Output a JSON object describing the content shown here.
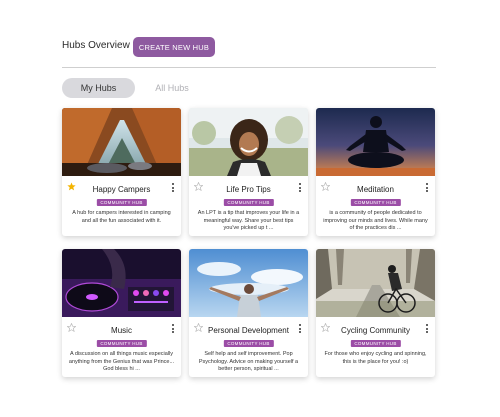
{
  "header": {
    "title": "Hubs Overview",
    "create_label": "CREATE NEW HUB"
  },
  "tabs": [
    {
      "label": "My Hubs",
      "active": true
    },
    {
      "label": "All Hubs",
      "active": false
    }
  ],
  "colors": {
    "accent": "#8e5aa0",
    "badge": "#9b4da6",
    "star_on": "#f4b400",
    "star_off": "#bdbdbd"
  },
  "hubs": [
    {
      "title": "Happy Campers",
      "badge": "COMMUNITY HUB",
      "starred": true,
      "description": "A hub for campers interested in camping and all the fun associated with it."
    },
    {
      "title": "Life Pro Tips",
      "badge": "COMMUNITY HUB",
      "starred": false,
      "description": "An LPT is a tip that improves your life in a meaningful way. Share your best tips you've picked up t ..."
    },
    {
      "title": "Meditation",
      "badge": "COMMUNITY HUB",
      "starred": false,
      "description": "is a community of people dedicated to improving our minds and lives. While many of the practices dis ..."
    },
    {
      "title": "Music",
      "badge": "COMMUNITY HUB",
      "starred": false,
      "description": "A discussion on all things music especially anything from the Genius that was Prince... God bless hi ..."
    },
    {
      "title": "Personal Development",
      "badge": "COMMUNITY HUB",
      "starred": false,
      "description": "Self help and self improvement. Pop Psychology. Advice on making yourself a better person, spiritual ..."
    },
    {
      "title": "Cycling Community",
      "badge": "COMMUNITY HUB",
      "starred": false,
      "description": "For those who enjoy cycling and spinning, this is the place for you! :o)"
    }
  ]
}
